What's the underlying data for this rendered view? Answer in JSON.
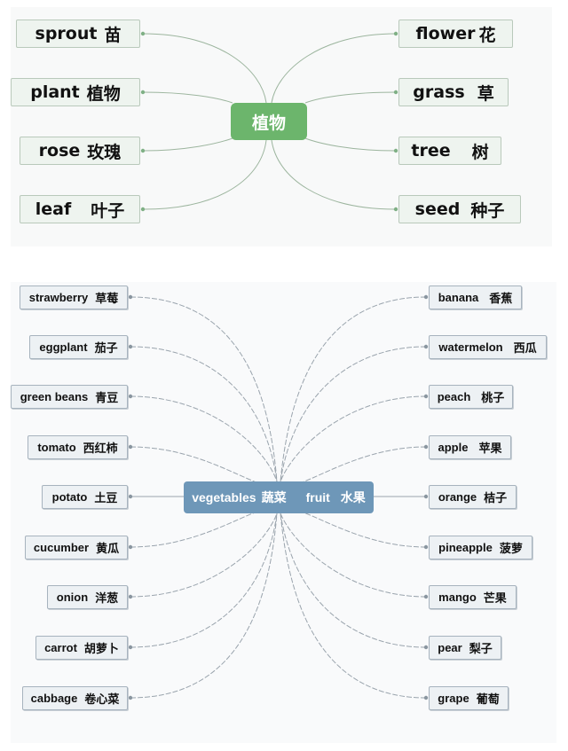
{
  "plants_map": {
    "center": "植物",
    "colors": {
      "center": "#6cb56c",
      "link": "#9cb59e",
      "dot": "#7fb085"
    },
    "left": [
      {
        "en": "sprout",
        "zh": "苗"
      },
      {
        "en": "plant",
        "zh": "植物"
      },
      {
        "en": "rose",
        "zh": "玫瑰"
      },
      {
        "en": "leaf",
        "zh": "叶子"
      }
    ],
    "right": [
      {
        "en": "flower",
        "zh": "花"
      },
      {
        "en": "grass",
        "zh": "草"
      },
      {
        "en": "tree",
        "zh": "树"
      },
      {
        "en": "seed",
        "zh": "种子"
      }
    ]
  },
  "food_map": {
    "center": {
      "vegetables_en": "vegetables",
      "vegetables_zh": "蔬菜",
      "fruit_en": "fruit",
      "fruit_zh": "水果"
    },
    "colors": {
      "center": "#6e97b8",
      "link": "#9aa4ad"
    },
    "vegetables": [
      {
        "en": "strawberry",
        "zh": "草莓"
      },
      {
        "en": "eggplant",
        "zh": "茄子"
      },
      {
        "en": "green beans",
        "zh": "青豆"
      },
      {
        "en": "tomato",
        "zh": "西红柿"
      },
      {
        "en": "potato",
        "zh": "土豆"
      },
      {
        "en": "cucumber",
        "zh": "黄瓜"
      },
      {
        "en": "onion",
        "zh": "洋葱"
      },
      {
        "en": "carrot",
        "zh": "胡萝卜"
      },
      {
        "en": "cabbage",
        "zh": "卷心菜"
      }
    ],
    "fruits": [
      {
        "en": "banana",
        "zh": "香蕉"
      },
      {
        "en": "watermelon",
        "zh": "西瓜"
      },
      {
        "en": "peach",
        "zh": "桃子"
      },
      {
        "en": "apple",
        "zh": "苹果"
      },
      {
        "en": "orange",
        "zh": "桔子"
      },
      {
        "en": "pineapple",
        "zh": "菠萝"
      },
      {
        "en": "mango",
        "zh": "芒果"
      },
      {
        "en": "pear",
        "zh": "梨子"
      },
      {
        "en": "grape",
        "zh": "葡萄"
      }
    ]
  }
}
